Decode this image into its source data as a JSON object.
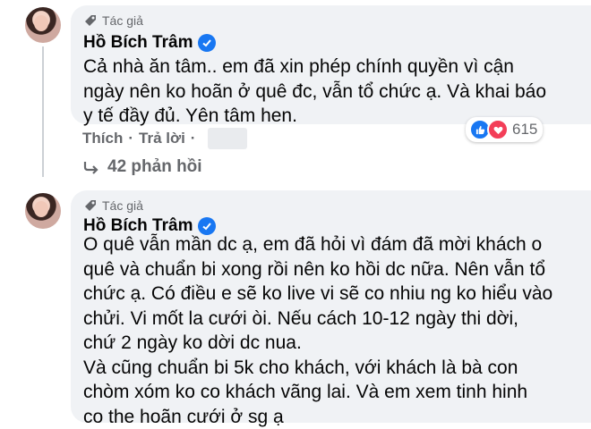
{
  "comments": [
    {
      "author_tag": "Tác giả",
      "name": "Hồ Bích Trâm",
      "text": "Cả nhà ăn tâm.. em đã xin phép chính quyền vì cận\nngày nên ko hoãn ở quê đc, vẫn tổ chức ạ. Và khai báo\ny tế đầy đủ. Yên tâm hen.",
      "actions": {
        "like": "Thích",
        "reply": "Trả lời"
      },
      "reaction_count": "615",
      "replies_label": "42 phản hồi"
    },
    {
      "author_tag": "Tác giả",
      "name": "Hồ Bích Trâm",
      "text": "O quê vẫn mần dc ạ, em đã hỏi vì đám đã mời khách o\nquê và chuẩn bi xong rồi nên ko hồi dc nữa. Nên vẫn tổ\nchức ạ. Có điều e sẽ ko live vi sẽ co nhiu ng ko hiểu vào\nchửi. Vi mốt la cưới òi. Nếu cách 10-12 ngày thi dời,\nchứ 2 ngày ko dời dc nua.\nVà cũng chuẩn bi 5k cho khách, với khách là bà con\nchòm xóm ko co khách vãng lai. Và em xem tinh hinh\nco the hoãn cưới ở sg ạ"
    }
  ],
  "icons": {
    "author_tag": "badge-icon",
    "verified": "verified-check-icon",
    "like": "thumbs-up-icon",
    "love": "heart-icon",
    "reply_arrow": "reply-arrow-icon"
  },
  "colors": {
    "accent": "#1877f2",
    "love": "#f33e58",
    "bubble": "#f0f2f5",
    "muted": "#65676b"
  }
}
